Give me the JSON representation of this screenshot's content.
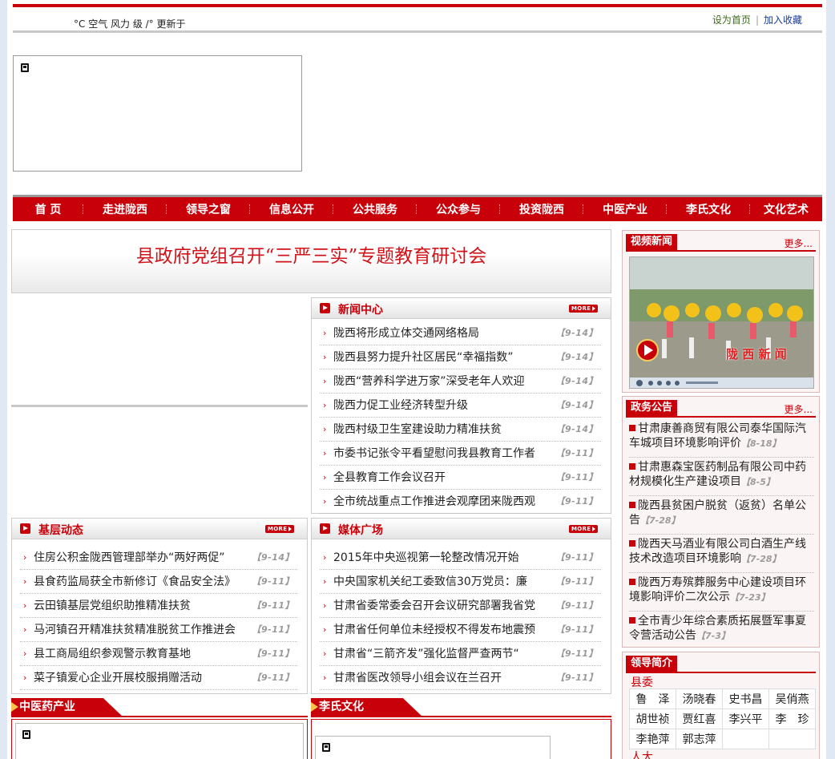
{
  "topbar": {
    "weather_text": "°C 空气   风力 级        /°   更新于",
    "set_home": "设为首页",
    "separator": "|",
    "add_favorite": "加入收藏"
  },
  "nav": {
    "items": [
      "首  页",
      "走进陇西",
      "领导之窗",
      "信息公开",
      "公共服务",
      "公众参与",
      "投资陇西",
      "中医产业",
      "李氏文化",
      "文化艺术"
    ]
  },
  "headline": "县政府党组召开“三严三实”专题教育研讨会",
  "more_label": "MORE",
  "news_center": {
    "title": "新闻中心",
    "items": [
      {
        "text": "陇西将形成立体交通网络格局",
        "date": "【9-14】"
      },
      {
        "text": "陇西县努力提升社区居民“幸福指数”",
        "date": "【9-14】"
      },
      {
        "text": "陇西“营养科学进万家”深受老年人欢迎",
        "date": "【9-14】"
      },
      {
        "text": "陇西力促工业经济转型升级",
        "date": "【9-14】"
      },
      {
        "text": "陇西村级卫生室建设助力精准扶贫",
        "date": "【9-14】"
      },
      {
        "text": "市委书记张令平看望慰问我县教育工作者",
        "date": "【9-11】"
      },
      {
        "text": "全县教育工作会议召开",
        "date": "【9-11】"
      },
      {
        "text": "全市统战重点工作推进会观摩团来陇西观",
        "date": "【9-11】"
      }
    ]
  },
  "grassroots": {
    "title": "基层动态",
    "items": [
      {
        "text": "住房公积金陇西管理部举办“两好两促”",
        "date": "【9-14】"
      },
      {
        "text": "县食药监局获全市新修订《食品安全法》",
        "date": "【9-11】"
      },
      {
        "text": "云田镇基层党组织助推精准扶贫",
        "date": "【9-11】"
      },
      {
        "text": "马河镇召开精准扶贫精准脱贫工作推进会",
        "date": "【9-11】"
      },
      {
        "text": "县工商局组织参观警示教育基地",
        "date": "【9-11】"
      },
      {
        "text": "菜子镇爱心企业开展校服捐赠活动",
        "date": "【9-11】"
      }
    ]
  },
  "media": {
    "title": "媒体广场",
    "items": [
      {
        "text": "2015年中央巡视第一轮整改情况开始",
        "date": "【9-11】"
      },
      {
        "text": "中央国家机关纪工委致信30万党员：廉",
        "date": "【9-11】"
      },
      {
        "text": "甘肃省委常委会召开会议研究部署我省党",
        "date": "【9-11】"
      },
      {
        "text": "甘肃省任何单位未经授权不得发布地震预",
        "date": "【9-11】"
      },
      {
        "text": "甘肃省“三箭齐发”强化监督严查两节“",
        "date": "【9-11】"
      },
      {
        "text": "甘肃省医改领导小组会议在兰召开",
        "date": "【9-11】"
      }
    ]
  },
  "tcm_section": "中医药产业",
  "li_section": "李氏文化",
  "video_news": {
    "title": "视频新闻",
    "more": "更多...",
    "caption": "陇 西 新 闻"
  },
  "gov_notice": {
    "title": "政务公告",
    "more": "更多...",
    "items": [
      {
        "text": "甘肃康善商贸有限公司泰华国际汽车城项目环境影响评价",
        "date": "【8-18】"
      },
      {
        "text": "甘肃惠森宝医药制品有限公司中药材规模化生产建设项目",
        "date": "【8-5】"
      },
      {
        "text": "陇西县贫困户脱贫（返贫）名单公告",
        "date": "【7-28】"
      },
      {
        "text": "陇西天马酒业有限公司白酒生产线技术改造项目环境影响",
        "date": "【7-28】"
      },
      {
        "text": "陇西万寿殡葬服务中心建设项目环境影响评价二次公示",
        "date": "【7-23】"
      },
      {
        "text": "全市青少年综合素质拓展暨军事夏令营活动公告",
        "date": "【7-3】"
      }
    ]
  },
  "leaders": {
    "title": "领导简介",
    "county_committee": "县委",
    "names": [
      [
        "鲁　泽",
        "汤晓春",
        "史书昌",
        "吴俏燕"
      ],
      [
        "胡世祯",
        "贾红喜",
        "李兴平",
        "李　珍"
      ],
      [
        "李艳萍",
        "郭志萍",
        "",
        ""
      ]
    ],
    "next_group": "人大"
  },
  "colors": {
    "brand_red": "#c8000a",
    "headline_red": "#d0141a",
    "date_grey": "#9a9a9a"
  }
}
